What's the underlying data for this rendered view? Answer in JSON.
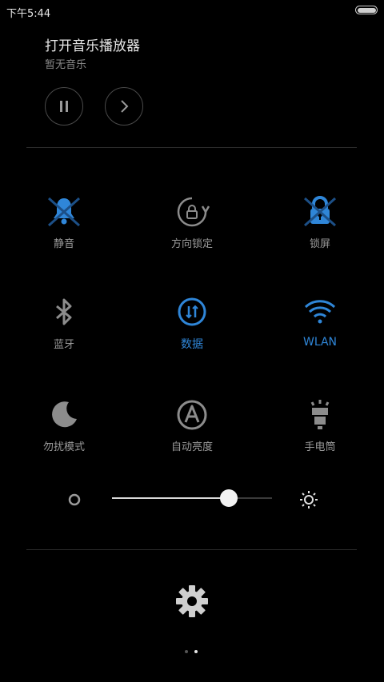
{
  "status_bar": {
    "time": "下午5:44"
  },
  "music": {
    "title": "打开音乐播放器",
    "subtitle": "暂无音乐",
    "pause_icon": "pause-icon",
    "next_icon": "chevron-right-icon"
  },
  "toggles": [
    {
      "label": "静音",
      "icon": "bell-icon",
      "active": false,
      "crossed": true
    },
    {
      "label": "方向锁定",
      "icon": "rotation-lock-icon",
      "active": false,
      "crossed": false
    },
    {
      "label": "锁屏",
      "icon": "lock-icon",
      "active": false,
      "crossed": true
    },
    {
      "label": "蓝牙",
      "icon": "bluetooth-icon",
      "active": false,
      "crossed": false
    },
    {
      "label": "数据",
      "icon": "mobile-data-icon",
      "active": true,
      "crossed": false
    },
    {
      "label": "WLAN",
      "icon": "wifi-icon",
      "active": true,
      "crossed": false
    },
    {
      "label": "勿扰模式",
      "icon": "moon-icon",
      "active": false,
      "crossed": false
    },
    {
      "label": "自动亮度",
      "icon": "auto-brightness-icon",
      "active": false,
      "crossed": false
    },
    {
      "label": "手电筒",
      "icon": "flashlight-icon",
      "active": false,
      "crossed": false
    }
  ],
  "brightness": {
    "level": 0.73,
    "low_icon": "brightness-low-icon",
    "high_icon": "brightness-high-icon"
  },
  "settings_icon": "gear-icon",
  "pager": {
    "page_count": 2,
    "current": 2
  },
  "colors": {
    "accent": "#2f86d8",
    "label": "#9a9a9a",
    "icon": "#8c8c8c"
  }
}
